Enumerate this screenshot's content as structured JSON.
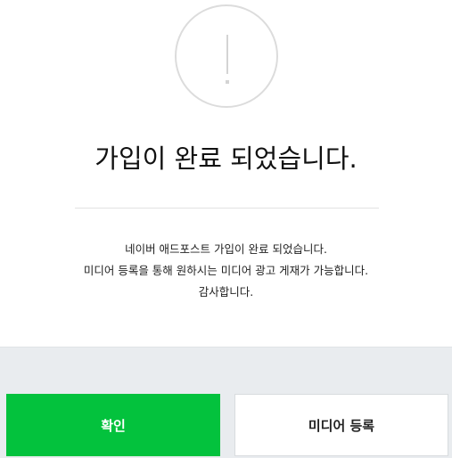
{
  "dialog": {
    "icon": "exclamation-icon",
    "title": "가입이 완료 되었습니다.",
    "messages": [
      "네이버 애드포스트 가입이 완료 되었습니다.",
      "미디어 등록을 통해 원하시는 미디어 광고 게재가 가능합니다.",
      "감사합니다."
    ],
    "buttons": {
      "confirm_label": "확인",
      "register_media_label": "미디어 등록"
    },
    "colors": {
      "confirm_bg": "#03c23d",
      "footer_bg": "#e9ecef"
    }
  }
}
